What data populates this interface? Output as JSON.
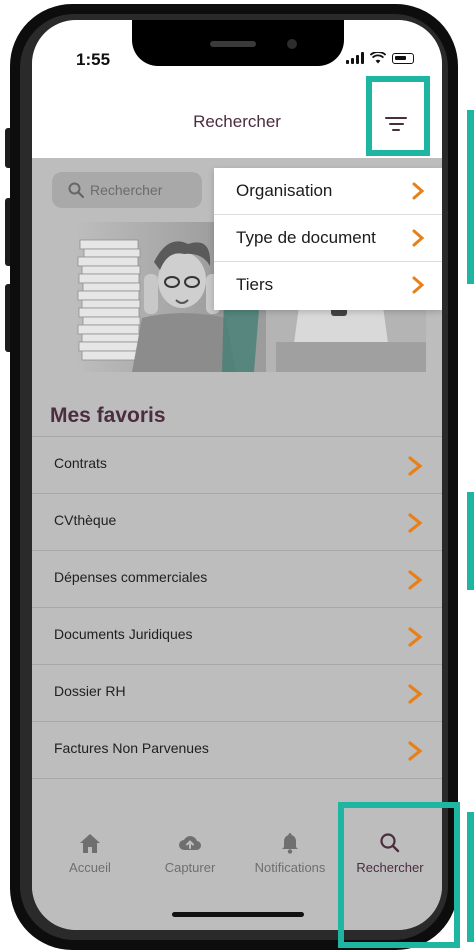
{
  "status_bar": {
    "time": "1:55"
  },
  "header": {
    "title": "Rechercher",
    "filter_icon": "filter-icon"
  },
  "search": {
    "placeholder": "Rechercher"
  },
  "dropdown": {
    "items": [
      {
        "label": "Organisation"
      },
      {
        "label": "Type de document"
      },
      {
        "label": "Tiers"
      }
    ]
  },
  "favorites": {
    "title": "Mes favoris",
    "items": [
      {
        "label": "Contrats"
      },
      {
        "label": "CVthèque"
      },
      {
        "label": "Dépenses commerciales"
      },
      {
        "label": "Documents Juridiques"
      },
      {
        "label": "Dossier RH"
      },
      {
        "label": "Factures Non Parvenues"
      }
    ]
  },
  "tabbar": {
    "tabs": [
      {
        "label": "Accueil",
        "icon": "home-icon"
      },
      {
        "label": "Capturer",
        "icon": "cloud-upload-icon"
      },
      {
        "label": "Notifications",
        "icon": "bell-icon"
      },
      {
        "label": "Rechercher",
        "icon": "search-icon",
        "active": true
      }
    ]
  },
  "colors": {
    "accent_orange": "#e8801a",
    "brand_plum": "#4a2d3f",
    "highlight_teal": "#1fb5a3",
    "dim_overlay": "#bdbdbd"
  }
}
